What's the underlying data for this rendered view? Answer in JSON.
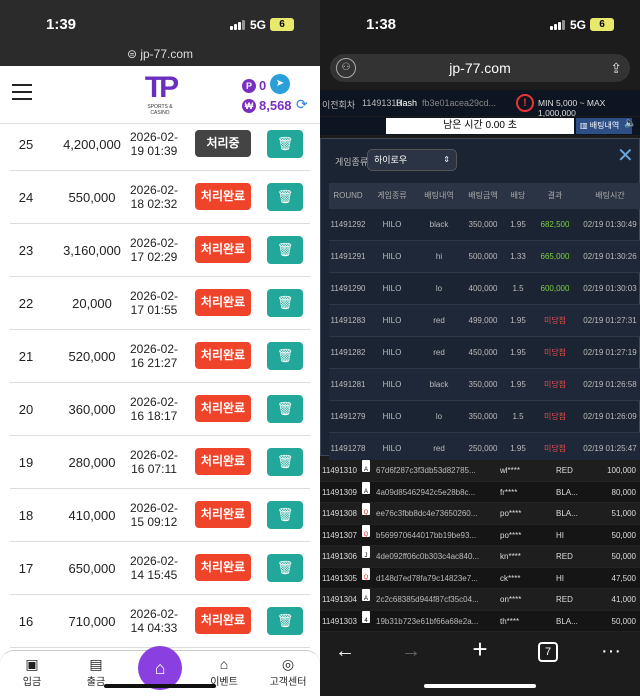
{
  "left": {
    "status": {
      "time": "1:39",
      "network": "5G",
      "battery": "6"
    },
    "url": "jp-77.com",
    "header": {
      "logo_text": "SPORTS & CASINO",
      "points_icon": "P",
      "points": "0",
      "won_icon": "₩",
      "balance": "8,568"
    },
    "rows": [
      {
        "no": "25",
        "amount": "4,200,000",
        "date": "2026-02-",
        "time": "19 01:39",
        "status": "처리중",
        "state": "proc"
      },
      {
        "no": "24",
        "amount": "550,000",
        "date": "2026-02-",
        "time": "18 02:32",
        "status": "처리완료",
        "state": "done"
      },
      {
        "no": "23",
        "amount": "3,160,000",
        "date": "2026-02-",
        "time": "17 02:29",
        "status": "처리완료",
        "state": "done"
      },
      {
        "no": "22",
        "amount": "20,000",
        "date": "2026-02-",
        "time": "17 01:55",
        "status": "처리완료",
        "state": "done"
      },
      {
        "no": "21",
        "amount": "520,000",
        "date": "2026-02-",
        "time": "16 21:27",
        "status": "처리완료",
        "state": "done"
      },
      {
        "no": "20",
        "amount": "360,000",
        "date": "2026-02-",
        "time": "16 18:17",
        "status": "처리완료",
        "state": "done"
      },
      {
        "no": "19",
        "amount": "280,000",
        "date": "2026-02-",
        "time": "16 07:11",
        "status": "처리완료",
        "state": "done"
      },
      {
        "no": "18",
        "amount": "410,000",
        "date": "2026-02-",
        "time": "15 09:12",
        "status": "처리완료",
        "state": "done"
      },
      {
        "no": "17",
        "amount": "650,000",
        "date": "2026-02-",
        "time": "14 15:45",
        "status": "처리완료",
        "state": "done"
      },
      {
        "no": "16",
        "amount": "710,000",
        "date": "2026-02-",
        "time": "14 04:33",
        "status": "처리완료",
        "state": "done"
      }
    ],
    "footer": {
      "deposit": "입금",
      "withdraw": "출금",
      "event": "이벤트",
      "support": "고객센터"
    }
  },
  "right": {
    "status": {
      "time": "1:38",
      "network": "5G",
      "battery": "6"
    },
    "url": "jp-77.com",
    "info": {
      "round_label": "이전회차",
      "round": "11491313",
      "hash_label": "Hash",
      "hash": "fb3e01acea29cd...",
      "limits": "MIN 5,000 ~ MAX 1,000,000"
    },
    "timer": "남은 시간 0.00 초",
    "bet_history_button": "배팅내역",
    "modal": {
      "game_type_label": "게임종류",
      "game_type_value": "하이로우",
      "columns": [
        "ROUND",
        "게임종류",
        "배팅내역",
        "배팅금액",
        "배당",
        "결과",
        "배팅시간"
      ],
      "rows": [
        {
          "round": "11491292",
          "game": "HILO",
          "pick": "black",
          "amount": "350,000",
          "odds": "1.95",
          "result": "682,500",
          "win": true,
          "time": "02/19 01:30:49"
        },
        {
          "round": "11491291",
          "game": "HILO",
          "pick": "hi",
          "amount": "500,000",
          "odds": "1.33",
          "result": "665,000",
          "win": true,
          "time": "02/19 01:30:26"
        },
        {
          "round": "11491290",
          "game": "HILO",
          "pick": "lo",
          "amount": "400,000",
          "odds": "1.5",
          "result": "600,000",
          "win": true,
          "time": "02/19 01:30:03"
        },
        {
          "round": "11491283",
          "game": "HILO",
          "pick": "red",
          "amount": "499,000",
          "odds": "1.95",
          "result": "미당첨",
          "win": false,
          "time": "02/19 01:27:31"
        },
        {
          "round": "11491282",
          "game": "HILO",
          "pick": "red",
          "amount": "450,000",
          "odds": "1.95",
          "result": "미당첨",
          "win": false,
          "time": "02/19 01:27:19"
        },
        {
          "round": "11491281",
          "game": "HILO",
          "pick": "black",
          "amount": "350,000",
          "odds": "1.95",
          "result": "미당첨",
          "win": false,
          "time": "02/19 01:26:58"
        },
        {
          "round": "11491279",
          "game": "HILO",
          "pick": "lo",
          "amount": "350,000",
          "odds": "1.5",
          "result": "미당첨",
          "win": false,
          "time": "02/19 01:26:09"
        },
        {
          "round": "11491278",
          "game": "HILO",
          "pick": "red",
          "amount": "250,000",
          "odds": "1.95",
          "result": "미당첨",
          "win": false,
          "time": "02/19 01:25:47"
        }
      ]
    },
    "feed": [
      {
        "round": "11491310",
        "card": "A",
        "red": false,
        "hash": "67d6f287c3f3db53d82785...",
        "user": "wl****",
        "pick": "RED",
        "amount": "100,000"
      },
      {
        "round": "11491309",
        "card": "A",
        "red": false,
        "hash": "4a09d85462942c5e28b8c...",
        "user": "fr****",
        "pick": "BLA...",
        "amount": "80,000"
      },
      {
        "round": "11491308",
        "card": "Q",
        "red": true,
        "hash": "ee76c3fbb8dc4e73650260...",
        "user": "po****",
        "pick": "BLA...",
        "amount": "51,000"
      },
      {
        "round": "11491307",
        "card": "Q",
        "red": true,
        "hash": "b569970644017bb19be93...",
        "user": "po****",
        "pick": "HI",
        "amount": "50,000"
      },
      {
        "round": "11491306",
        "card": "J",
        "red": false,
        "hash": "4de092ff06c0b303c4ac840...",
        "user": "kn****",
        "pick": "RED",
        "amount": "50,000"
      },
      {
        "round": "11491305",
        "card": "Q",
        "red": true,
        "hash": "d148d7ed78fa79c14823e7...",
        "user": "ck****",
        "pick": "HI",
        "amount": "47,500"
      },
      {
        "round": "11491304",
        "card": "A",
        "red": false,
        "hash": "2c2c68385d944f87cf35c04...",
        "user": "on****",
        "pick": "RED",
        "amount": "41,000"
      },
      {
        "round": "11491303",
        "card": "4",
        "red": false,
        "hash": "19b31b723e61bf66a68e2a...",
        "user": "th****",
        "pick": "BLA...",
        "amount": "50,000"
      }
    ],
    "nav": {
      "tabs": "7"
    }
  }
}
